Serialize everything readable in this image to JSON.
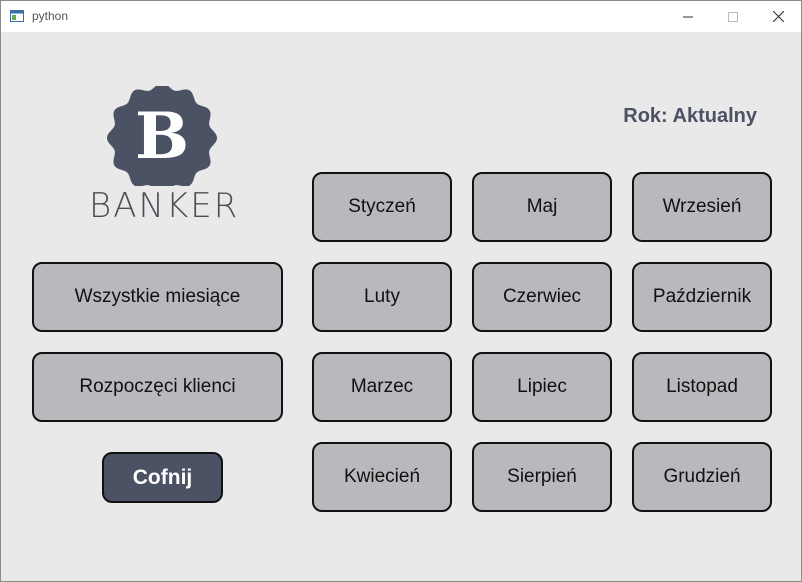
{
  "window": {
    "title": "python",
    "controls": {
      "minimize": "minimize-icon",
      "maximize": "maximize-icon",
      "close": "close-icon"
    }
  },
  "logo": {
    "letter": "B",
    "text": "BANKER",
    "badge_color": "#4a5263"
  },
  "year_label": "Rok: Aktualny",
  "left_buttons": {
    "all_months": "Wszystkie miesiące",
    "started_clients": "Rozpoczęci klienci",
    "back": "Cofnij"
  },
  "months": {
    "jan": "Styczeń",
    "feb": "Luty",
    "mar": "Marzec",
    "apr": "Kwiecień",
    "may": "Maj",
    "jun": "Czerwiec",
    "jul": "Lipiec",
    "aug": "Sierpień",
    "sep": "Wrzesień",
    "oct": "Październik",
    "nov": "Listopad",
    "dec": "Grudzień"
  },
  "colors": {
    "button_face": "#b9b8bd",
    "button_border": "#121212",
    "accent": "#4a5263",
    "background": "#e9e9e9"
  }
}
